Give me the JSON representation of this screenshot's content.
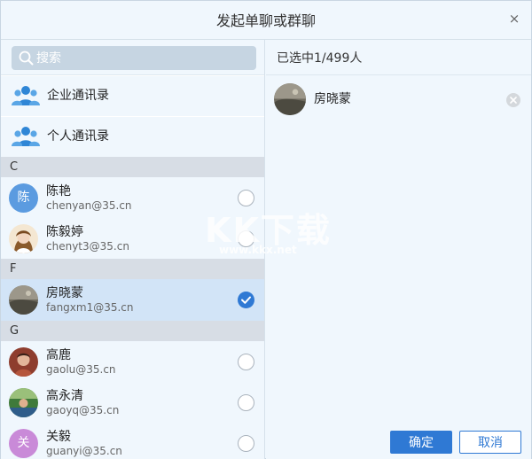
{
  "dialog": {
    "title": "发起单聊或群聊",
    "close_glyph": "×"
  },
  "search": {
    "placeholder": "搜索"
  },
  "directories": [
    {
      "label": "企业通讯录",
      "icon": "org-contacts-icon"
    },
    {
      "label": "个人通讯录",
      "icon": "personal-contacts-icon"
    }
  ],
  "groups": [
    {
      "letter": "C"
    },
    {
      "letter": "F"
    },
    {
      "letter": "G"
    }
  ],
  "contacts": [
    {
      "name": "陈艳",
      "email": "chenyan@35.cn",
      "avatar_text": "陈",
      "avatar_color": "#5b9be0",
      "checked": false
    },
    {
      "name": "陈毅婷",
      "email": "chenyt3@35.cn",
      "avatar_text": "",
      "checked": false
    },
    {
      "name": "房晓蒙",
      "email": "fangxm1@35.cn",
      "avatar_text": "",
      "checked": true
    },
    {
      "name": "高鹿",
      "email": "gaolu@35.cn",
      "avatar_text": "",
      "checked": false
    },
    {
      "name": "高永清",
      "email": "gaoyq@35.cn",
      "avatar_text": "",
      "checked": false
    },
    {
      "name": "关毅",
      "email": "guanyi@35.cn",
      "avatar_text": "关",
      "avatar_color": "#c98ad8",
      "checked": false
    }
  ],
  "selected_panel": {
    "header": "已选中1/499人",
    "items": [
      {
        "name": "房晓蒙"
      }
    ]
  },
  "buttons": {
    "ok": "确定",
    "cancel": "取消"
  },
  "watermark": {
    "text": "KK下载",
    "url": "www.kkx.net"
  },
  "colors": {
    "accent": "#2f79d4",
    "pane_bg": "#f0f7fd",
    "selected_row": "#d2e4f7",
    "group_header": "#d7dde5"
  }
}
